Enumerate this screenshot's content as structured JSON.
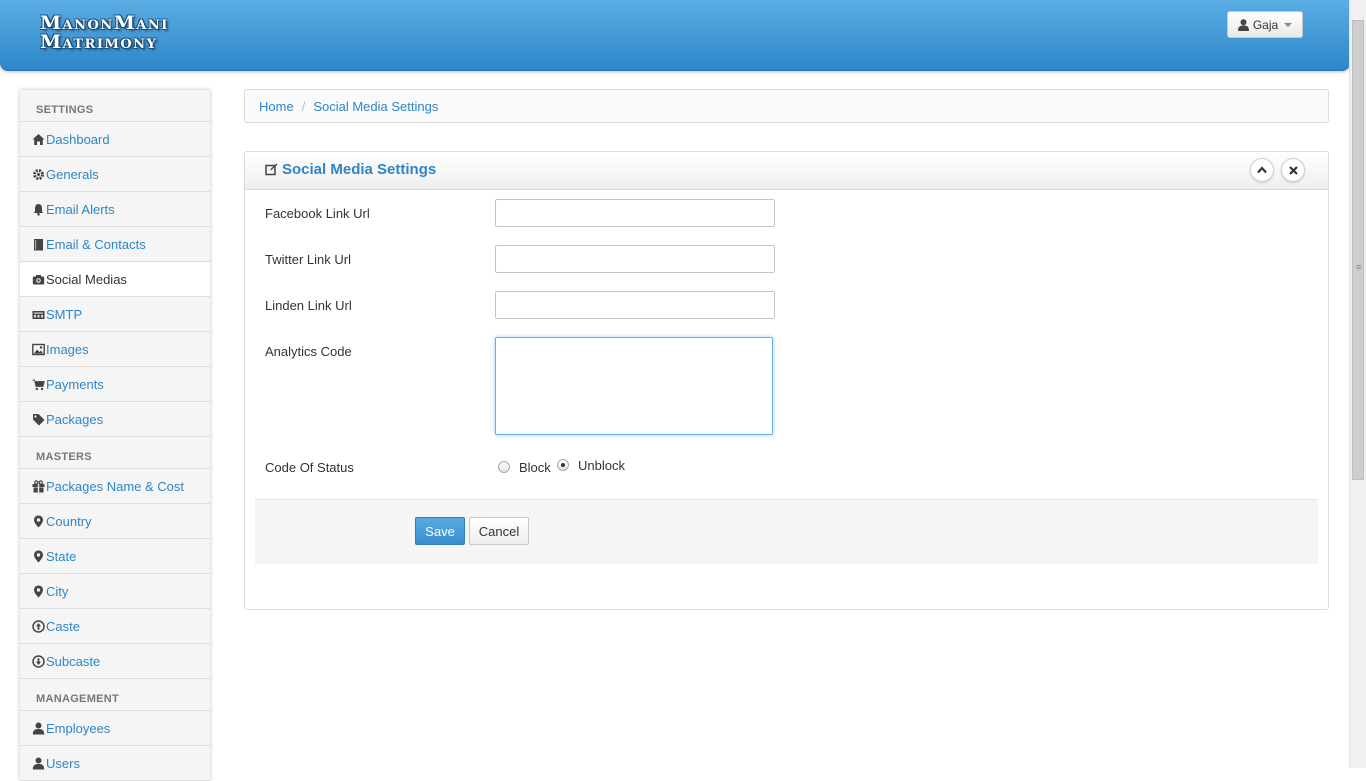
{
  "brand": {
    "line1": "ManonMani",
    "line2": "Matrimony"
  },
  "header": {
    "user_name": "Gaja",
    "user_icon": "user-icon"
  },
  "sidebar": {
    "sections": [
      {
        "title": "SETTINGS",
        "items": [
          {
            "label": "Dashboard",
            "icon": "home-icon",
            "active": false
          },
          {
            "label": "Generals",
            "icon": "gear-icon",
            "active": false
          },
          {
            "label": "Email Alerts",
            "icon": "bell-icon",
            "active": false
          },
          {
            "label": "Email & Contacts",
            "icon": "book-icon",
            "active": false
          },
          {
            "label": "Social Medias",
            "icon": "camera-icon",
            "active": true
          },
          {
            "label": "SMTP",
            "icon": "server-icon",
            "active": false
          },
          {
            "label": "Images",
            "icon": "picture-icon",
            "active": false
          },
          {
            "label": "Payments",
            "icon": "cart-icon",
            "active": false
          },
          {
            "label": "Packages",
            "icon": "tag-icon",
            "active": false
          }
        ]
      },
      {
        "title": "MASTERS",
        "items": [
          {
            "label": "Packages Name & Cost",
            "icon": "gift-icon",
            "active": false
          },
          {
            "label": "Country",
            "icon": "map-marker-icon",
            "active": false
          },
          {
            "label": "State",
            "icon": "map-marker-icon",
            "active": false
          },
          {
            "label": "City",
            "icon": "map-marker-icon",
            "active": false
          },
          {
            "label": "Caste",
            "icon": "circle-arrow-up-icon",
            "active": false
          },
          {
            "label": "Subcaste",
            "icon": "circle-arrow-down-icon",
            "active": false
          }
        ]
      },
      {
        "title": "MANAGEMENT",
        "items": [
          {
            "label": "Employees",
            "icon": "user-icon",
            "active": false
          },
          {
            "label": "Users",
            "icon": "user-icon",
            "active": false
          }
        ]
      }
    ]
  },
  "breadcrumb": {
    "home": "Home",
    "separator": "/",
    "current": "Social Media Settings"
  },
  "panel": {
    "title": "Social Media Settings",
    "title_icon": "edit-icon",
    "collapse_icon": "chevron-up-icon",
    "close_icon": "close-icon"
  },
  "form": {
    "facebook_label": "Facebook Link Url",
    "facebook_value": "",
    "twitter_label": "Twitter Link Url",
    "twitter_value": "",
    "linden_label": "Linden Link Url",
    "linden_value": "",
    "analytics_label": "Analytics Code",
    "analytics_value": "",
    "status_label": "Code Of Status",
    "status_options": [
      "Block",
      "Unblock"
    ],
    "status_selected": "Unblock",
    "save_label": "Save",
    "cancel_label": "Cancel"
  },
  "colors": {
    "accent": "#2f86c5",
    "header_top": "#5aaee4",
    "header_bottom": "#2e86c9"
  }
}
